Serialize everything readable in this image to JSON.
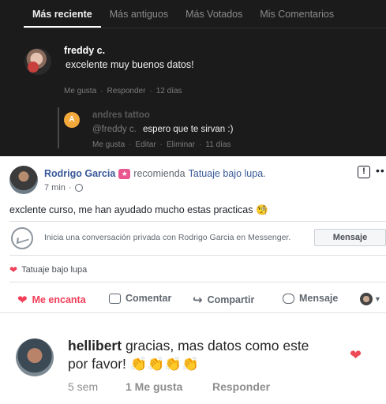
{
  "dark_comments": {
    "tabs": [
      "Más reciente",
      "Más antiguos",
      "Más Votados",
      "Mis Comentarios"
    ],
    "comment1": {
      "author": "freddy c.",
      "text": "excelente muy buenos datos!",
      "like": "Me gusta",
      "reply": "Responder",
      "time": "12 días"
    },
    "reply": {
      "avatar_letter": "A",
      "author": "andres tattoo",
      "mention": "@freddy c.",
      "text": "espero que te sirvan :)",
      "like": "Me gusta",
      "edit": "Editar",
      "delete": "Eliminar",
      "time": "11 días"
    }
  },
  "facebook_post": {
    "author": "Rodrigo Garcia",
    "verb": "recomienda",
    "page": "Tatuaje bajo lupa.",
    "time": "7 min",
    "text": "exclente curso, me han ayudado mucho estas practicas 🧐",
    "messenger_prompt": "Inicia una conversación privada con Rodrigo Garcia en Messenger.",
    "messenger_button": "Mensaje",
    "reacted_page": "Tatuaje bajo lupa",
    "actions": {
      "love": "Me encanta",
      "comment": "Comentar",
      "share": "Compartir",
      "message": "Mensaje"
    }
  },
  "instagram_comment": {
    "username": "hellibert",
    "text_line1": "gracias, mas datos como este",
    "text_line2": "por favor! 👏👏👏👏",
    "time": "5 sem",
    "likes": "1 Me gusta",
    "reply": "Responder"
  },
  "colors": {
    "dark_bg": "#1b1b1b",
    "fb_link": "#385898",
    "love_red": "#f33e58",
    "ig_heart": "#ed4956",
    "reply_avatar": "#f2a83a"
  }
}
